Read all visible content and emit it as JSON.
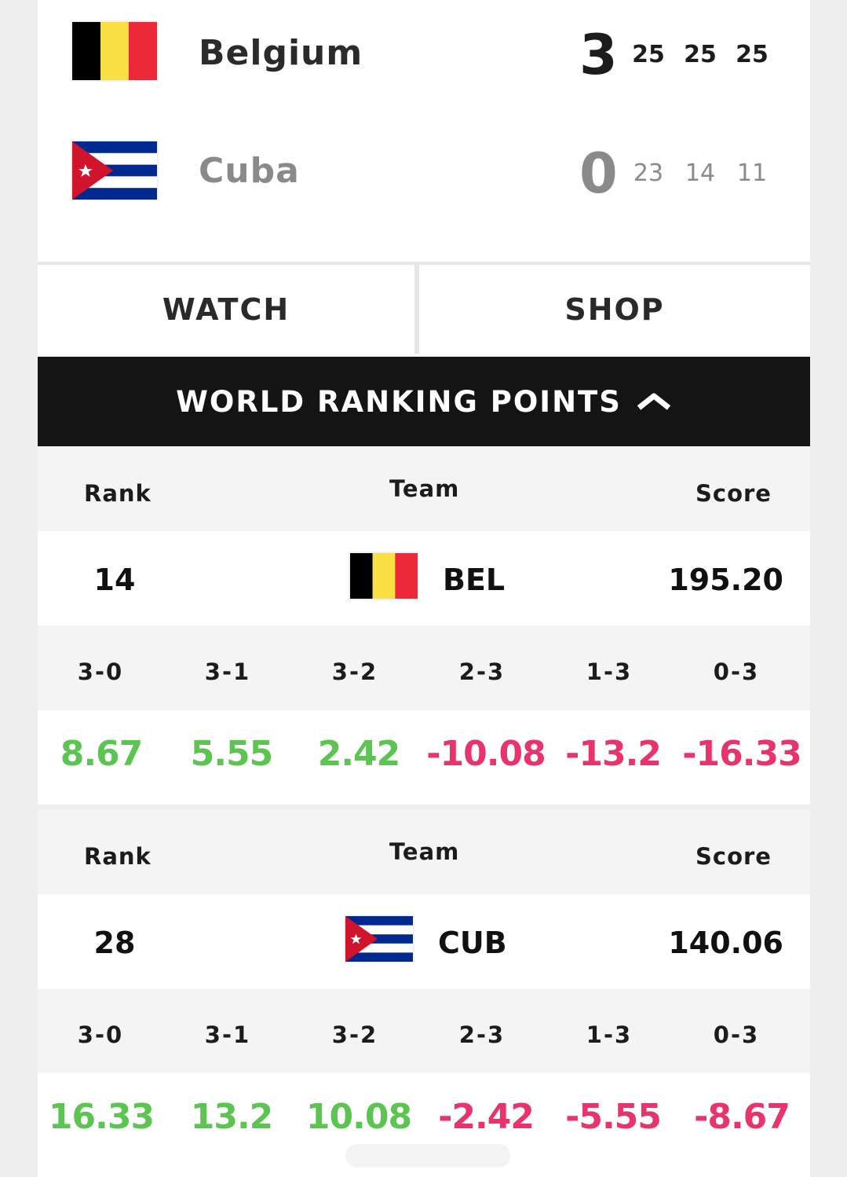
{
  "match": {
    "home": {
      "name": "Belgium",
      "sets_won": "3",
      "set_scores": [
        "25",
        "25",
        "25"
      ],
      "flag": "belgium-flag"
    },
    "away": {
      "name": "Cuba",
      "sets_won": "0",
      "set_scores": [
        "23",
        "14",
        "11"
      ],
      "flag": "cuba-flag"
    }
  },
  "actions": {
    "watch_label": "WATCH",
    "shop_label": "SHOP"
  },
  "ranking": {
    "title": "WORLD RANKING POINTS",
    "chevron": "chevron-up-icon",
    "headers": {
      "rank": "Rank",
      "team": "Team",
      "score": "Score"
    },
    "teams": [
      {
        "rank": "14",
        "code": "BEL",
        "score": "195.20",
        "outcomes": [
          "3-0",
          "3-1",
          "3-2",
          "2-3",
          "1-3",
          "0-3"
        ],
        "points": [
          "8.67",
          "5.55",
          "2.42",
          "-10.08",
          "-13.2",
          "-16.33"
        ]
      },
      {
        "rank": "28",
        "code": "CUB",
        "score": "140.06",
        "outcomes": [
          "3-0",
          "3-1",
          "3-2",
          "2-3",
          "1-3",
          "0-3"
        ],
        "points": [
          "16.33",
          "13.2",
          "10.08",
          "-2.42",
          "-5.55",
          "-8.67"
        ]
      }
    ]
  },
  "colors": {
    "positive": "#5cc451",
    "negative": "#e8336b",
    "header_bg": "#141414",
    "belgium": [
      "#000000",
      "#fae042",
      "#ed2939"
    ],
    "cuba": [
      "#002a8f",
      "#ffffff",
      "#cf142b"
    ]
  }
}
